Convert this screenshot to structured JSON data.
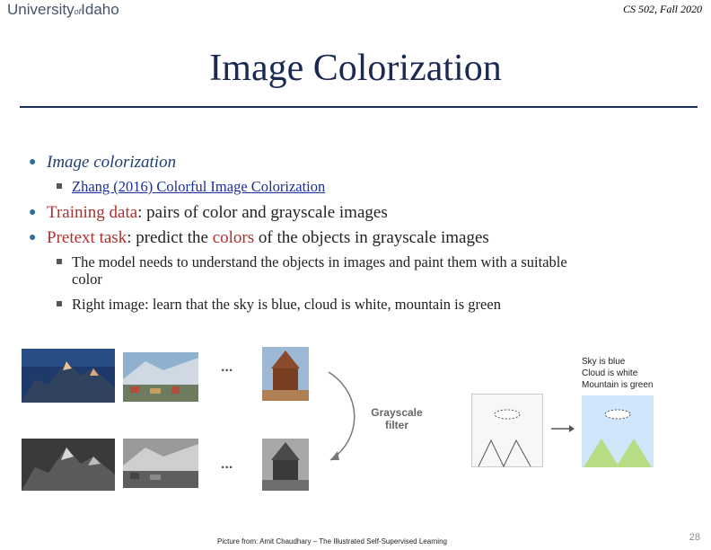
{
  "header": {
    "logo_part1": "University",
    "logo_of": "of",
    "logo_part2": "Idaho",
    "course": "CS 502, Fall 2020"
  },
  "slide": {
    "title": "Image Colorization",
    "bullet1": "Image colorization",
    "sub1_link": "Zhang (2016) Colorful Image Colorization",
    "bullet2_term": "Training data",
    "bullet2_rest": ": pairs of color and grayscale images",
    "bullet3_term": "Pretext task",
    "bullet3_mid": ": predict the ",
    "bullet3_colors": "colors",
    "bullet3_rest": " of the objects in grayscale images",
    "sub2_line1": "The model needs to understand the objects in images and paint them with a suitable",
    "sub2_line2": "color",
    "sub3": "Right image: learn that the sky is blue, cloud is white, mountain is green"
  },
  "figure": {
    "ellipsis_top": "...",
    "ellipsis_bottom": "...",
    "filter_label_line1": "Grayscale",
    "filter_label_line2": "filter",
    "note_line1": "Sky is blue",
    "note_line2": "Cloud is white",
    "note_line3": "Mountain is green",
    "colors": {
      "sky": "#cfe6fb",
      "mountain": "#b7dc83",
      "accent": "#1b2a55"
    }
  },
  "footer": {
    "credit": "Picture from: Amit Chaudhary – The Illustrated Self-Supervised Learning",
    "page_number": "28"
  }
}
